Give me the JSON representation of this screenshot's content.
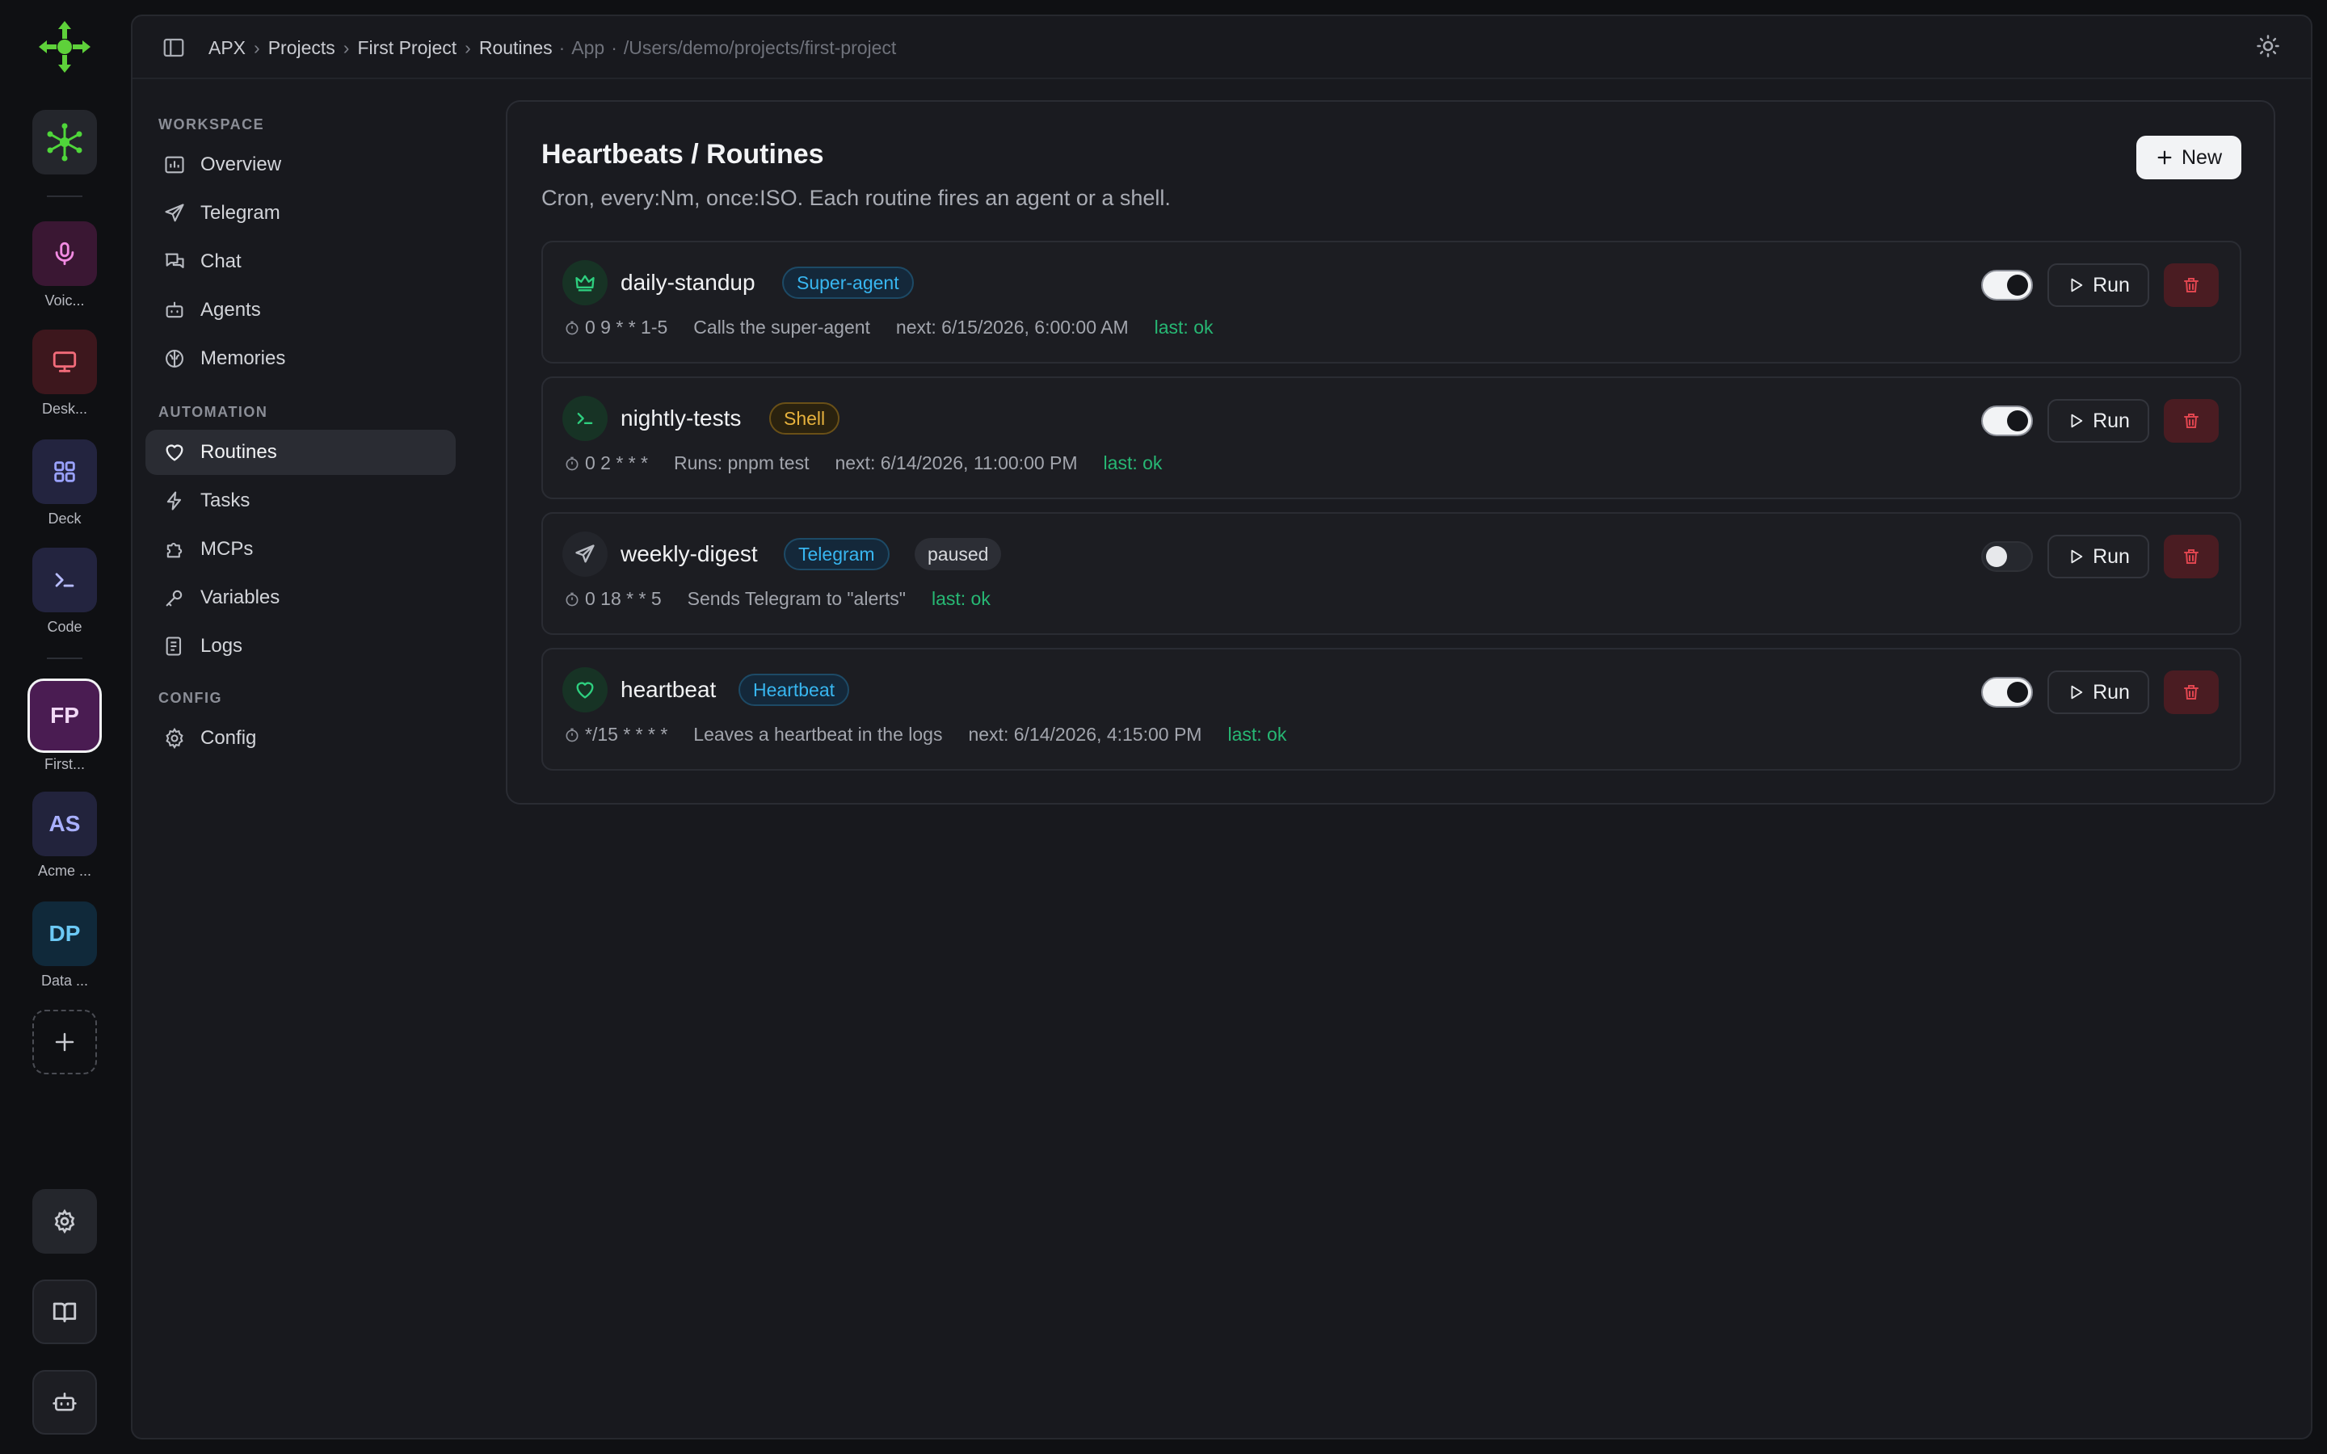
{
  "rail": {
    "apps": [
      {
        "label": "Voic...",
        "icon": "microphone-icon"
      },
      {
        "label": "Desk...",
        "icon": "monitor-icon"
      },
      {
        "label": "Deck",
        "icon": "grid-icon"
      },
      {
        "label": "Code",
        "icon": "terminal-icon"
      }
    ],
    "workspaces": [
      {
        "initials": "FP",
        "label": "First..."
      },
      {
        "initials": "AS",
        "label": "Acme ..."
      },
      {
        "initials": "DP",
        "label": "Data ..."
      }
    ]
  },
  "breadcrumb": {
    "items": [
      "APX",
      "Projects",
      "First Project",
      "Routines"
    ],
    "app": "App",
    "path": "/Users/demo/projects/first-project"
  },
  "nav": {
    "workspace_title": "WORKSPACE",
    "workspace_items": [
      "Overview",
      "Telegram",
      "Chat",
      "Agents",
      "Memories"
    ],
    "automation_title": "AUTOMATION",
    "automation_items": [
      "Routines",
      "Tasks",
      "MCPs",
      "Variables",
      "Logs"
    ],
    "config_title": "CONFIG",
    "config_items": [
      "Config"
    ]
  },
  "page": {
    "title": "Heartbeats / Routines",
    "subtitle": "Cron, every:Nm, once:ISO. Each routine fires an agent or a shell.",
    "new_label": "New",
    "run_label": "Run"
  },
  "routines": [
    {
      "name": "daily-standup",
      "badge": "Super-agent",
      "schedule": "0 9 * * 1-5",
      "description": "Calls the super-agent",
      "next": "next: 6/15/2026, 6:00:00 AM",
      "last": "last: ok",
      "enabled": true
    },
    {
      "name": "nightly-tests",
      "badge": "Shell",
      "schedule": "0 2 * * *",
      "description": "Runs: pnpm test",
      "next": "next: 6/14/2026, 11:00:00 PM",
      "last": "last: ok",
      "enabled": true
    },
    {
      "name": "weekly-digest",
      "badge": "Telegram",
      "status": "paused",
      "schedule": "0 18 * * 5",
      "description": "Sends Telegram to \"alerts\"",
      "last": "last: ok",
      "enabled": false
    },
    {
      "name": "heartbeat",
      "badge": "Heartbeat",
      "schedule": "*/15 * * * *",
      "description": "Leaves a heartbeat in the logs",
      "next": "next: 6/14/2026, 4:15:00 PM",
      "last": "last: ok",
      "enabled": true
    }
  ],
  "colors": {
    "accent_green": "#27b874",
    "badge_blue": "#38b6f0",
    "badge_amber": "#e7b23d",
    "delete_red": "#e0454f"
  }
}
